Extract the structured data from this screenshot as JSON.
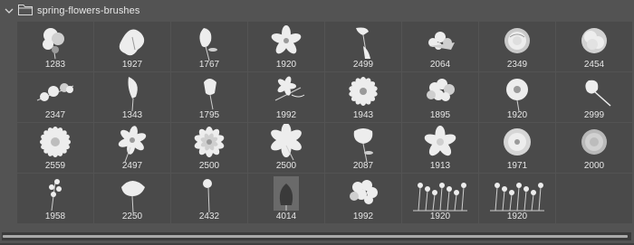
{
  "group": {
    "name": "spring-flowers-brushes",
    "expanded": true
  },
  "brushes": [
    {
      "size": "1283",
      "icon": "flower-cluster"
    },
    {
      "size": "1927",
      "icon": "iris"
    },
    {
      "size": "1767",
      "icon": "tulip-bud"
    },
    {
      "size": "1920",
      "icon": "lily"
    },
    {
      "size": "2499",
      "icon": "bell-flower"
    },
    {
      "size": "2064",
      "icon": "bouquet"
    },
    {
      "size": "2349",
      "icon": "rose"
    },
    {
      "size": "2454",
      "icon": "peony"
    },
    {
      "size": "2347",
      "icon": "flower-branch"
    },
    {
      "size": "1343",
      "icon": "calla-lily"
    },
    {
      "size": "1795",
      "icon": "tulip"
    },
    {
      "size": "1992",
      "icon": "lily-stem"
    },
    {
      "size": "1943",
      "icon": "daisy"
    },
    {
      "size": "1895",
      "icon": "hydrangea"
    },
    {
      "size": "1920",
      "icon": "poppy"
    },
    {
      "size": "2999",
      "icon": "bud-stem"
    },
    {
      "size": "2559",
      "icon": "gerbera"
    },
    {
      "size": "2497",
      "icon": "anemone"
    },
    {
      "size": "2500",
      "icon": "dahlia"
    },
    {
      "size": "2500",
      "icon": "lily-open"
    },
    {
      "size": "2087",
      "icon": "poppy-stem"
    },
    {
      "size": "1913",
      "icon": "wild-rose"
    },
    {
      "size": "1971",
      "icon": "camellia"
    },
    {
      "size": "2000",
      "icon": "ranunculus"
    },
    {
      "size": "1958",
      "icon": "wildflower-sprig"
    },
    {
      "size": "2250",
      "icon": "poppy-single"
    },
    {
      "size": "2432",
      "icon": "small-bud"
    },
    {
      "size": "4014",
      "icon": "leaf-silhouette"
    },
    {
      "size": "1992",
      "icon": "flower-bunch"
    },
    {
      "size": "1920",
      "icon": "meadow"
    },
    {
      "size": "1920",
      "icon": "meadow-2"
    }
  ],
  "colors": {
    "panel_bg": "#535353",
    "cell_bg": "#4a4a4a",
    "text": "#e6e6e6",
    "scrollbar_thumb": "#a9a9a9"
  }
}
